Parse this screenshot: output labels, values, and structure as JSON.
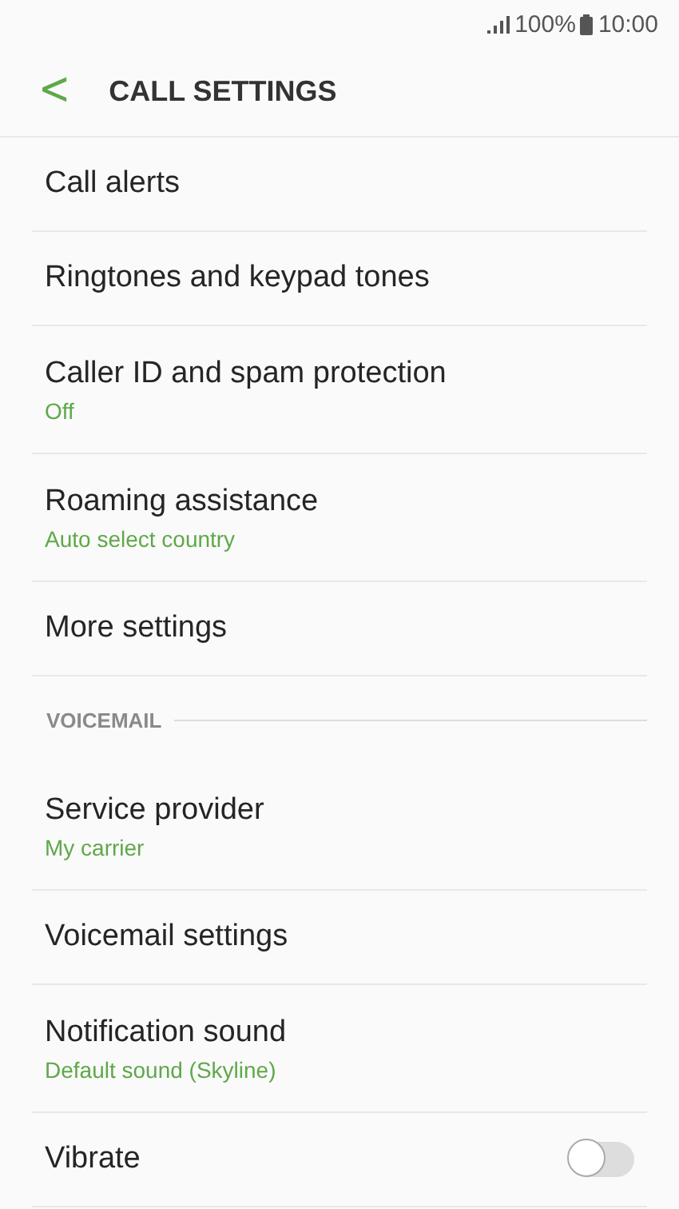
{
  "status_bar": {
    "battery": "100%",
    "time": "10:00"
  },
  "header": {
    "back": "<",
    "title": "CALL SETTINGS"
  },
  "items": [
    {
      "kind": "item",
      "title": "Call alerts"
    },
    {
      "kind": "item",
      "title": "Ringtones and keypad tones"
    },
    {
      "kind": "item",
      "title": "Caller ID and spam protection",
      "subtitle": "Off"
    },
    {
      "kind": "item",
      "title": "Roaming assistance",
      "subtitle": "Auto select country"
    },
    {
      "kind": "item",
      "title": "More settings"
    },
    {
      "kind": "section",
      "title": "VOICEMAIL"
    },
    {
      "kind": "item",
      "title": "Service provider",
      "subtitle": "My carrier"
    },
    {
      "kind": "item",
      "title": "Voicemail settings"
    },
    {
      "kind": "item",
      "title": "Notification sound",
      "subtitle": "Default sound (Skyline)"
    },
    {
      "kind": "switch",
      "title": "Vibrate",
      "on": false
    }
  ]
}
